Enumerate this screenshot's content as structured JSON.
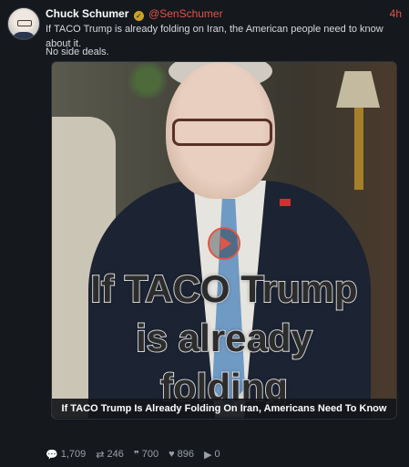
{
  "post": {
    "author_name": "Chuck Schumer",
    "handle": "@SenSchumer",
    "time": "4h",
    "text_line1": "If TACO Trump is already folding on Iran, the American people need to know about it.",
    "text_line2": "No side deals.",
    "media": {
      "caption_line1": "If TACO Trump",
      "caption_line2": "is already",
      "caption_line3": "folding",
      "title": "If TACO Trump Is Already Folding On Iran, Americans Need To Know"
    },
    "stats": {
      "replies": "1,709",
      "reposts": "246",
      "quotes": "700",
      "likes": "896",
      "views": "0"
    }
  },
  "colors": {
    "accent": "#e0554a",
    "background": "#15181d"
  },
  "icons": [
    "verified-icon",
    "play-icon",
    "reply-icon",
    "repost-icon",
    "quote-icon",
    "like-icon",
    "views-icon"
  ]
}
